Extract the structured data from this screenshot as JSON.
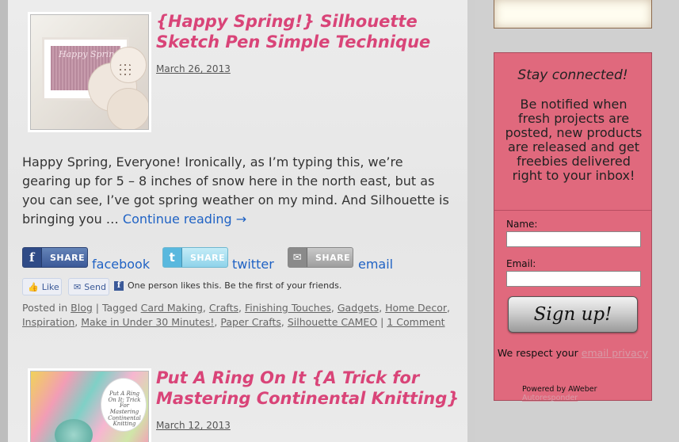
{
  "posts": [
    {
      "title_line1": "{Happy Spring!} Silhouette",
      "title_line2": "Sketch Pen Simple Technique",
      "date": "March 26, 2013",
      "thumbnail_text": "Happy Spring"
    },
    {
      "title_line1": "Put A Ring On It {A Trick for",
      "title_line2": "Mastering Continental Knitting}",
      "date": "March 12, 2013",
      "thumbnail_text": "Put A Ring On It: Trick For Mastering Continental Knitting"
    }
  ],
  "excerpt": {
    "text": "Happy Spring, Everyone! Ironically, as I’m typing this, we’re gearing up for 5 – 8 inches of snow here in the north east, but as you can see, I’ve got spring weather on my mind. And Silhouette is bringing you …",
    "continue_link": "Continue reading →"
  },
  "share": {
    "button_label": "SHARE",
    "facebook": "facebook",
    "twitter": "twitter",
    "email": "email"
  },
  "fb_widget": {
    "like": "Like",
    "send": "Send",
    "text": "One person likes this. Be the first of your friends."
  },
  "meta": {
    "posted_in_label": "Posted in",
    "category": "Blog",
    "tagged_label": "Tagged",
    "tags": [
      "Card Making",
      "Crafts",
      "Finishing Touches",
      "Gadgets",
      "Home Decor",
      "Inspiration",
      "Make in Under 30 Minutes!",
      "Paper Crafts",
      "Silhouette CAMEO"
    ],
    "comments": "1 Comment"
  },
  "sidebar": {
    "widget_title": "Stay connected!",
    "widget_desc": "Be notified when fresh projects are posted, new products are released and get freebies delivered right to your inbox!",
    "name_label": "Name:",
    "email_label": "Email:",
    "name_value": "",
    "email_value": "",
    "signup_label": "Sign up!",
    "privacy_prefix": "We respect your",
    "privacy_link": "email privacy",
    "powered_prefix": "Powered by AWeber",
    "powered_link": "Autoresponder"
  },
  "colors": {
    "title_pink": "#d94478",
    "link_blue": "#1f62c4",
    "widget_pink": "#e0697d"
  }
}
